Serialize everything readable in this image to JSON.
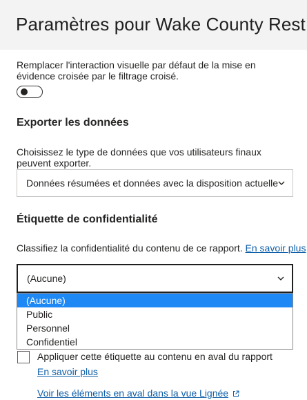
{
  "header": {
    "title": "Paramètres pour Wake County Rest..."
  },
  "crossfilter": {
    "description": "Remplacer l'interaction visuelle par défaut de la mise en évidence croisée par le filtrage croisé.",
    "toggle_on": false
  },
  "export": {
    "heading": "Exporter les données",
    "description": "Choisissez le type de données que vos utilisateurs finaux peuvent exporter.",
    "selected": "Données résumées et données avec la disposition actuelle"
  },
  "sensitivity": {
    "heading": "Étiquette de confidentialité",
    "description": "Classifiez la confidentialité du contenu de ce rapport.",
    "learn_more": "En savoir plus",
    "selected": "(Aucune)",
    "options": [
      "(Aucune)",
      "Public",
      "Personnel",
      "Confidentiel"
    ],
    "apply_downstream_label": "Appliquer cette étiquette au contenu en aval du rapport",
    "apply_learn_more": "En savoir plus",
    "lineage_link": "Voir les éléments en aval dans la vue Lignée"
  },
  "colors": {
    "accent": "#1e88f4",
    "link": "#0e5ea8"
  }
}
